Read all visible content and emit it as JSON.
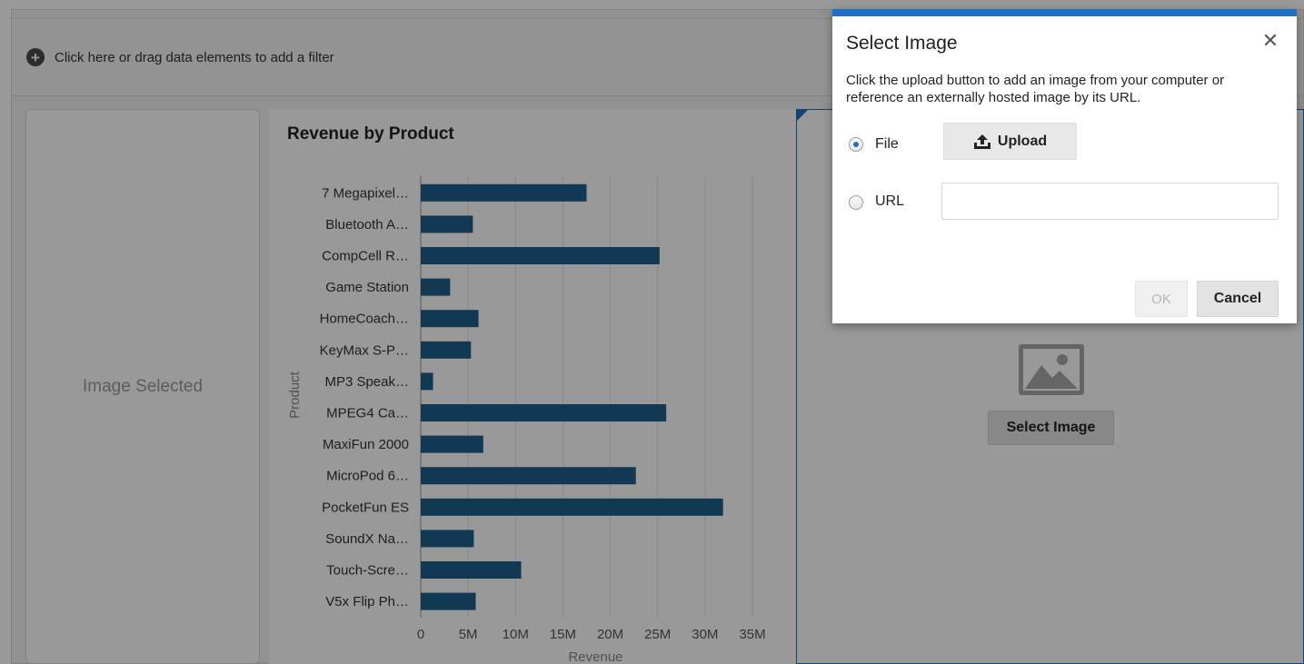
{
  "filter_bar": {
    "text": "Click here or drag data elements to add a filter",
    "icon": "plus-circle-icon"
  },
  "image_card": {
    "label": "Image Selected"
  },
  "right_panel": {
    "button_label": "Select Image",
    "icon": "image-placeholder-icon"
  },
  "dialog": {
    "title": "Select Image",
    "close_icon": "close-icon",
    "description": "Click the upload button to add an image from your computer or reference an externally hosted image by its URL.",
    "file_label": "File",
    "url_label": "URL",
    "upload_label": "Upload",
    "upload_icon": "upload-icon",
    "url_value": "",
    "ok_label": "OK",
    "cancel_label": "Cancel",
    "selected_option": "File"
  },
  "colors": {
    "accent": "#1f6fc5",
    "bar": "#1f5f8c"
  },
  "chart_data": {
    "type": "bar",
    "orientation": "horizontal",
    "title": "Revenue by Product",
    "xlabel": "Revenue",
    "ylabel": "Product",
    "categories": [
      "7 Megapixel…",
      "Bluetooth A…",
      "CompCell R…",
      "Game Station",
      "HomeCoach…",
      "KeyMax S-P…",
      "MP3 Speak…",
      "MPEG4 Ca…",
      "MaxiFun 2000",
      "MicroPod 6…",
      "PocketFun ES",
      "SoundX Na…",
      "Touch-Scre…",
      "V5x Flip Ph…"
    ],
    "values": [
      17500000,
      5500000,
      25200000,
      3100000,
      6100000,
      5300000,
      1300000,
      25900000,
      6600000,
      22700000,
      31900000,
      5600000,
      10600000,
      5800000
    ],
    "xlim": [
      0,
      35000000
    ],
    "ticks": [
      "0",
      "5M",
      "10M",
      "15M",
      "20M",
      "25M",
      "30M",
      "35M"
    ],
    "grid": true
  }
}
